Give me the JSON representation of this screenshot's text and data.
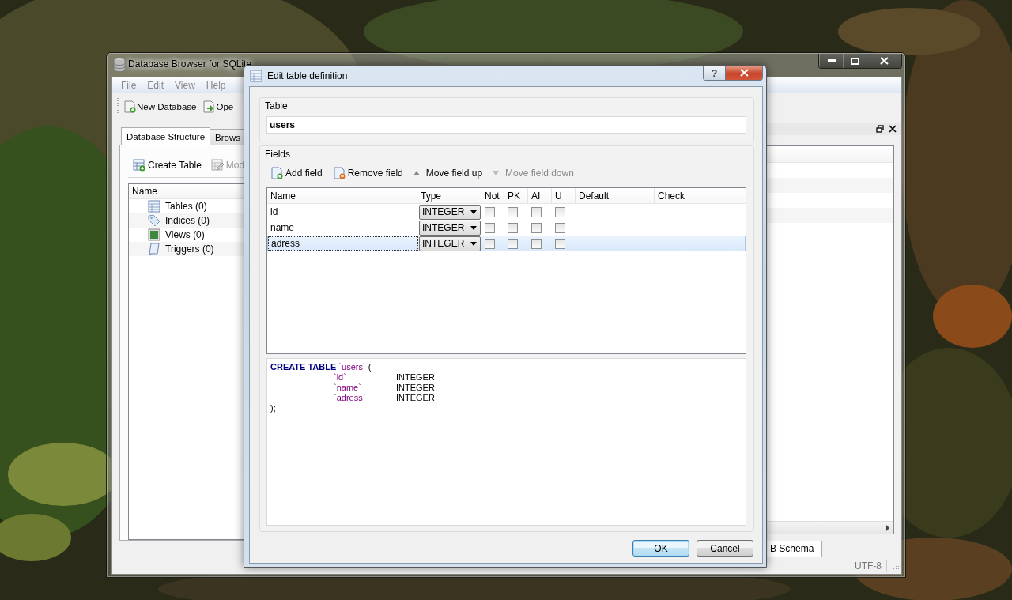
{
  "main_window": {
    "title": "Database Browser for SQLite",
    "menu": [
      "File",
      "Edit",
      "View",
      "Help"
    ],
    "toolbar": [
      {
        "kind": "new",
        "label": "New Database"
      },
      {
        "kind": "open",
        "label": "Ope"
      }
    ],
    "tabs": [
      {
        "label": "Database Structure",
        "selected": true
      },
      {
        "label": "Brows",
        "selected": false
      }
    ],
    "structure_actions": [
      {
        "kind": "create",
        "label": "Create Table",
        "disabled": false
      },
      {
        "kind": "modify",
        "label": "Mod",
        "disabled": true
      }
    ],
    "tree": {
      "column": "Name",
      "items": [
        {
          "kind": "tables",
          "label": "Tables (0)"
        },
        {
          "kind": "indices",
          "label": "Indices (0)"
        },
        {
          "kind": "views",
          "label": "Views (0)"
        },
        {
          "kind": "triggers",
          "label": "Triggers (0)"
        }
      ]
    },
    "dock_tabs": [
      {
        "label": "B Schema",
        "selected": true
      }
    ],
    "status_bar": "UTF-8"
  },
  "dialog": {
    "title": "Edit table definition",
    "help_button": "?",
    "table_group": "Table",
    "table_name": "users",
    "fields_group": "Fields",
    "toolbar": [
      {
        "kind": "add",
        "label": "Add field",
        "disabled": false
      },
      {
        "kind": "remove",
        "label": "Remove field",
        "disabled": false
      },
      {
        "kind": "up",
        "label": "Move field up",
        "disabled": false
      },
      {
        "kind": "down",
        "label": "Move field down",
        "disabled": true
      }
    ],
    "columns": [
      "Name",
      "Type",
      "Not",
      "PK",
      "AI",
      "U",
      "Default",
      "Check"
    ],
    "rows": [
      {
        "name": "id",
        "type": "INTEGER",
        "not": false,
        "pk": false,
        "ai": false,
        "u": false,
        "selected": false
      },
      {
        "name": "name",
        "type": "INTEGER",
        "not": false,
        "pk": false,
        "ai": false,
        "u": false,
        "selected": false
      },
      {
        "name": "adress",
        "type": "INTEGER",
        "not": false,
        "pk": false,
        "ai": false,
        "u": false,
        "selected": true
      }
    ],
    "sql": {
      "keyword": "CREATE TABLE",
      "table": "`users`",
      "open": "(",
      "columns": [
        {
          "name": "`id`",
          "type": "INTEGER,"
        },
        {
          "name": "`name`",
          "type": "INTEGER,"
        },
        {
          "name": "`adress`",
          "type": "INTEGER"
        }
      ],
      "close": ");"
    },
    "buttons": [
      {
        "label": "OK",
        "default": true
      },
      {
        "label": "Cancel",
        "default": false
      }
    ]
  }
}
